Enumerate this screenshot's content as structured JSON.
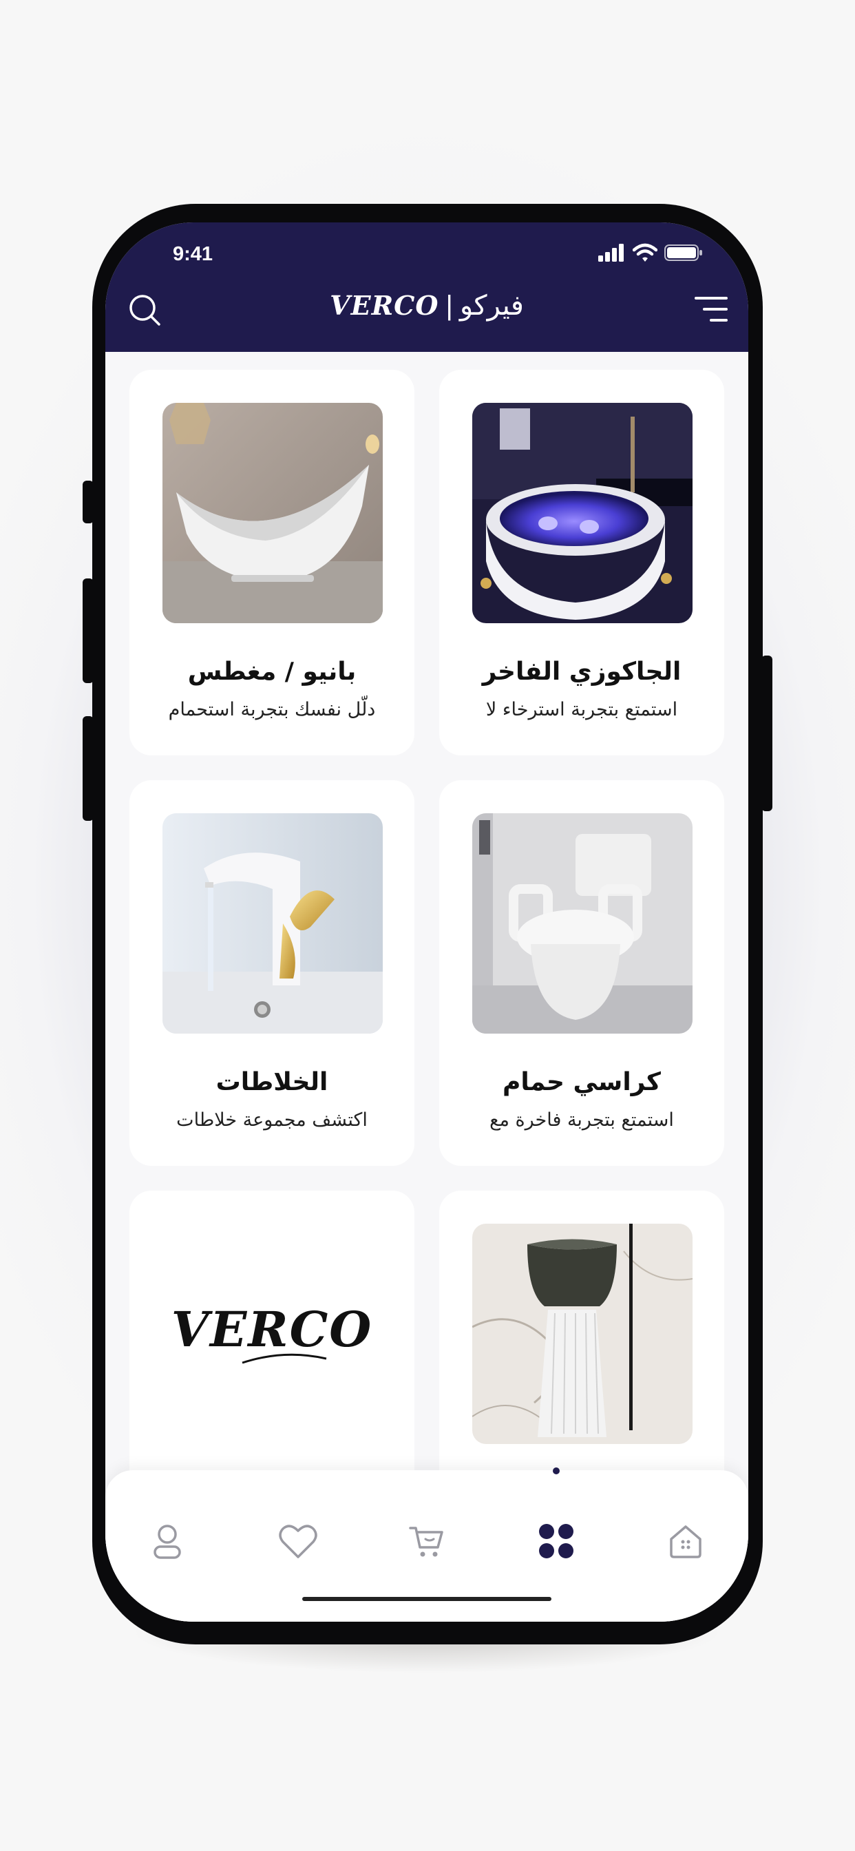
{
  "status_bar": {
    "time": "9:41"
  },
  "header": {
    "brand_latin": "VERCO",
    "brand_separator": "|",
    "brand_arabic": "فيركو"
  },
  "icons": {
    "search": "search-icon",
    "menu": "menu-icon",
    "profile": "user-icon",
    "favorites": "heart-icon",
    "cart": "cart-icon",
    "categories": "grid-icon",
    "home": "home-icon"
  },
  "categories": [
    {
      "title": "الجاكوزي الفاخر",
      "subtitle": "استمتع بتجربة استرخاء لا"
    },
    {
      "title": "بانيو / مغطس",
      "subtitle": "دلّل نفسك بتجربة استحمام"
    },
    {
      "title": "كراسي حمام",
      "subtitle": "استمتع بتجربة فاخرة مع"
    },
    {
      "title": "الخلاطات",
      "subtitle": "اكتشف مجموعة خلاطات"
    }
  ],
  "brand_card": {
    "logo_text": "VERCO"
  },
  "colors": {
    "primary": "#1f1b4d",
    "active_nav": "#1f1b4d",
    "inactive_nav": "#9a9aa2",
    "card_bg": "#ffffff",
    "page_bg": "#f7f7f9"
  }
}
